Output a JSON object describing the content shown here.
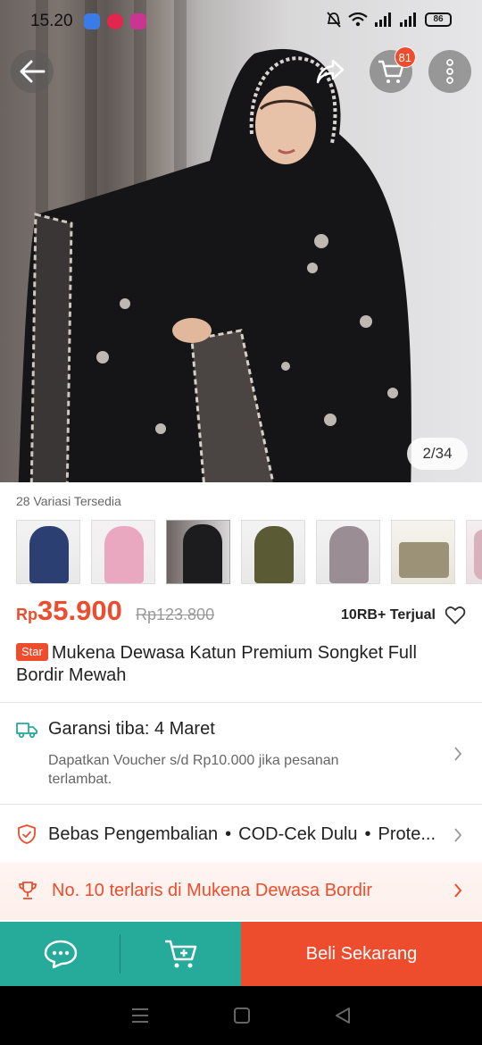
{
  "status_bar": {
    "time": "15.20",
    "battery": "86"
  },
  "hero": {
    "cart_count": "81",
    "image_counter": "2/34"
  },
  "variants": {
    "label": "28 Variasi Tersedia",
    "thumbs": [
      {
        "color": "#2c3f73"
      },
      {
        "color": "#e9a8c0"
      },
      {
        "color": "#1c1c1e"
      },
      {
        "color": "#5a5a35"
      },
      {
        "color": "#9a8d93"
      },
      {
        "color": "#9b9277"
      },
      {
        "color": "#d7b2bd"
      }
    ]
  },
  "price": {
    "currency": "Rp",
    "value": "35.900",
    "original": "Rp123.800",
    "sold": "10RB+ Terjual"
  },
  "product": {
    "badge": "Star",
    "title": "Mukena Dewasa Katun Premium Songket Full Bordir Mewah"
  },
  "shipping": {
    "title": "Garansi tiba: 4 Maret",
    "subtitle": "Dapatkan Voucher s/d Rp10.000 jika pesanan terlambat."
  },
  "services": {
    "items": [
      "Bebas Pengembalian",
      "COD-Cek Dulu",
      "Prote..."
    ]
  },
  "rank": {
    "text": "No. 10 terlaris di Mukena Dewasa Bordir"
  },
  "actions": {
    "buy_now": "Beli Sekarang"
  },
  "colors": {
    "brand": "#ee4d2d",
    "teal": "#26aa99"
  }
}
